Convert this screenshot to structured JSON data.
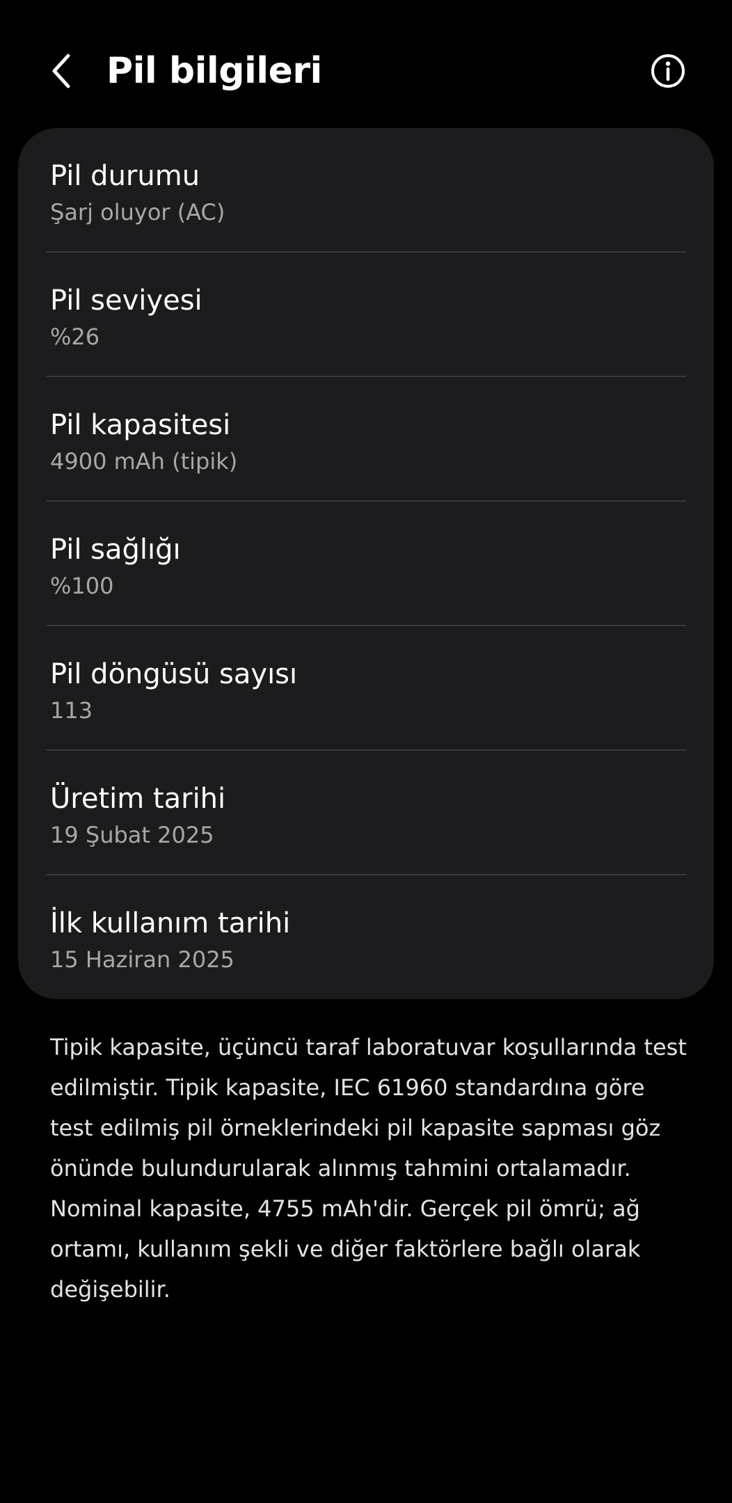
{
  "header": {
    "title": "Pil bilgileri",
    "back_icon": "chevron-left-icon",
    "info_icon": "info-circle-icon"
  },
  "items": [
    {
      "title": "Pil durumu",
      "value": "Şarj oluyor (AC)"
    },
    {
      "title": "Pil seviyesi",
      "value": "%26"
    },
    {
      "title": "Pil kapasitesi",
      "value": "4900 mAh (tipik)"
    },
    {
      "title": "Pil sağlığı",
      "value": "%100"
    },
    {
      "title": "Pil döngüsü sayısı",
      "value": "113"
    },
    {
      "title": "Üretim tarihi",
      "value": "19 Şubat 2025"
    },
    {
      "title": "İlk kullanım tarihi",
      "value": "15 Haziran 2025"
    }
  ],
  "footnote": "Tipik kapasite, üçüncü taraf laboratuvar koşullarında test edilmiştir. Tipik kapasite, IEC 61960 standardına göre test edilmiş pil örneklerindeki pil kapasite sapması göz önünde bulundurularak alınmış tahmini ortalamadır. Nominal kapasite, 4755 mAh'dir. Gerçek pil ömrü; ağ ortamı, kullanım şekli ve diğer faktörlere bağlı olarak değişebilir.",
  "colors": {
    "background": "#000000",
    "card": "#1c1c1e",
    "divider": "#3a3a3c",
    "primary_text": "#ffffff",
    "secondary_text": "#a8a8a8"
  }
}
